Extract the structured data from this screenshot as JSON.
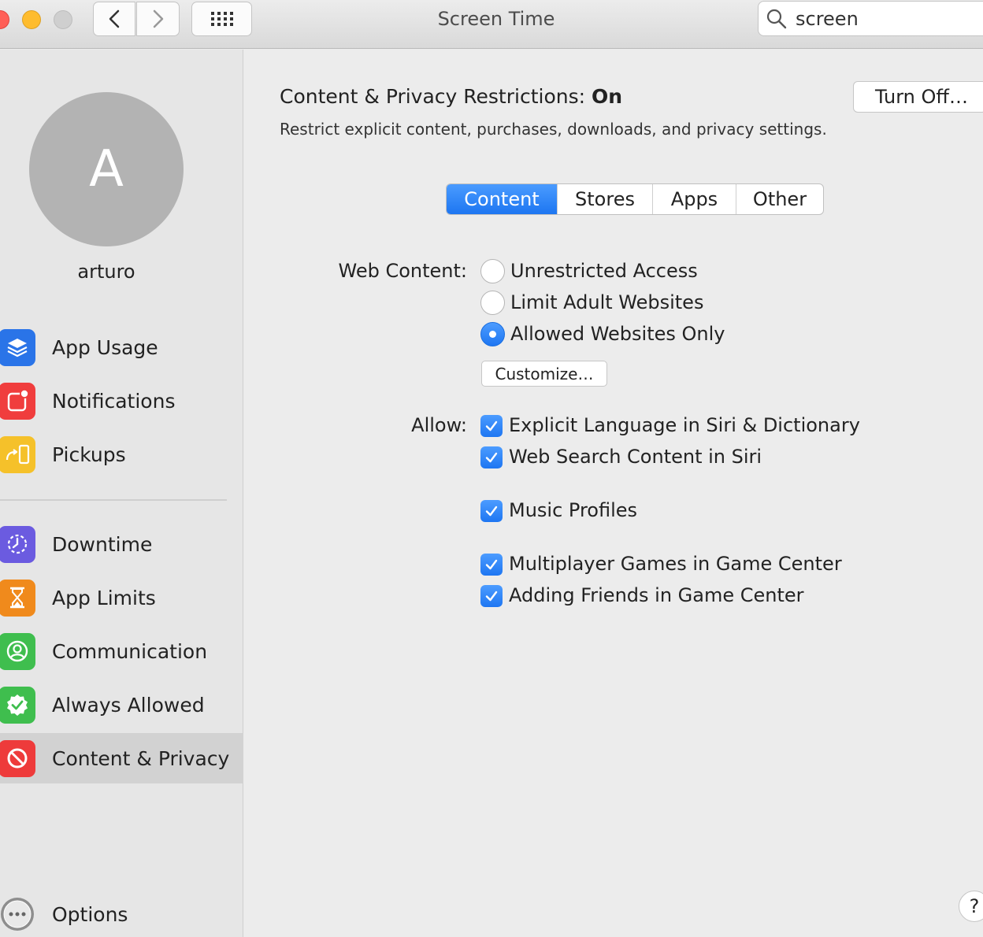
{
  "window": {
    "title": "Screen Time"
  },
  "search": {
    "value": "screen"
  },
  "user": {
    "initial": "A",
    "name": "arturo"
  },
  "sidebar": {
    "items": [
      {
        "label": "App Usage",
        "icon": "layers-icon"
      },
      {
        "label": "Notifications",
        "icon": "notification-badge-icon"
      },
      {
        "label": "Pickups",
        "icon": "phone-pickup-icon"
      },
      {
        "label": "Downtime",
        "icon": "downtime-clock-icon"
      },
      {
        "label": "App Limits",
        "icon": "hourglass-icon"
      },
      {
        "label": "Communication",
        "icon": "person-circle-icon"
      },
      {
        "label": "Always Allowed",
        "icon": "check-badge-icon"
      },
      {
        "label": "Content & Privacy",
        "icon": "prohibited-icon",
        "selected": true
      },
      {
        "label": "Options",
        "icon": "more-icon"
      }
    ]
  },
  "main": {
    "status_label": "Content & Privacy Restrictions:",
    "status_value": "On",
    "description": "Restrict explicit content, purchases, downloads, and privacy settings.",
    "turn_off_label": "Turn Off…",
    "tabs": [
      "Content",
      "Stores",
      "Apps",
      "Other"
    ],
    "active_tab": "Content",
    "web_content": {
      "label": "Web Content:",
      "options": [
        "Unrestricted Access",
        "Limit Adult Websites",
        "Allowed Websites Only"
      ],
      "selected": "Allowed Websites Only",
      "customize_label": "Customize…"
    },
    "allow": {
      "label": "Allow:",
      "items": [
        {
          "label": "Explicit Language in Siri & Dictionary",
          "checked": true
        },
        {
          "label": "Web Search Content in Siri",
          "checked": true
        },
        {
          "label": "Music Profiles",
          "checked": true
        },
        {
          "label": "Multiplayer Games in Game Center",
          "checked": true
        },
        {
          "label": "Adding Friends in Game Center",
          "checked": true
        }
      ]
    },
    "help_label": "?"
  },
  "colors": {
    "accent": "#1e76f2",
    "sidebar_selected": "#d2d2d2",
    "app_usage": "#2a74e8",
    "notifications": "#f03d3d",
    "pickups": "#f5c12a",
    "downtime": "#6b5be0",
    "app_limits": "#f08a1c",
    "communication": "#3fbe4e",
    "always_allowed": "#3fbe4e",
    "content_privacy": "#ee3b3b"
  }
}
